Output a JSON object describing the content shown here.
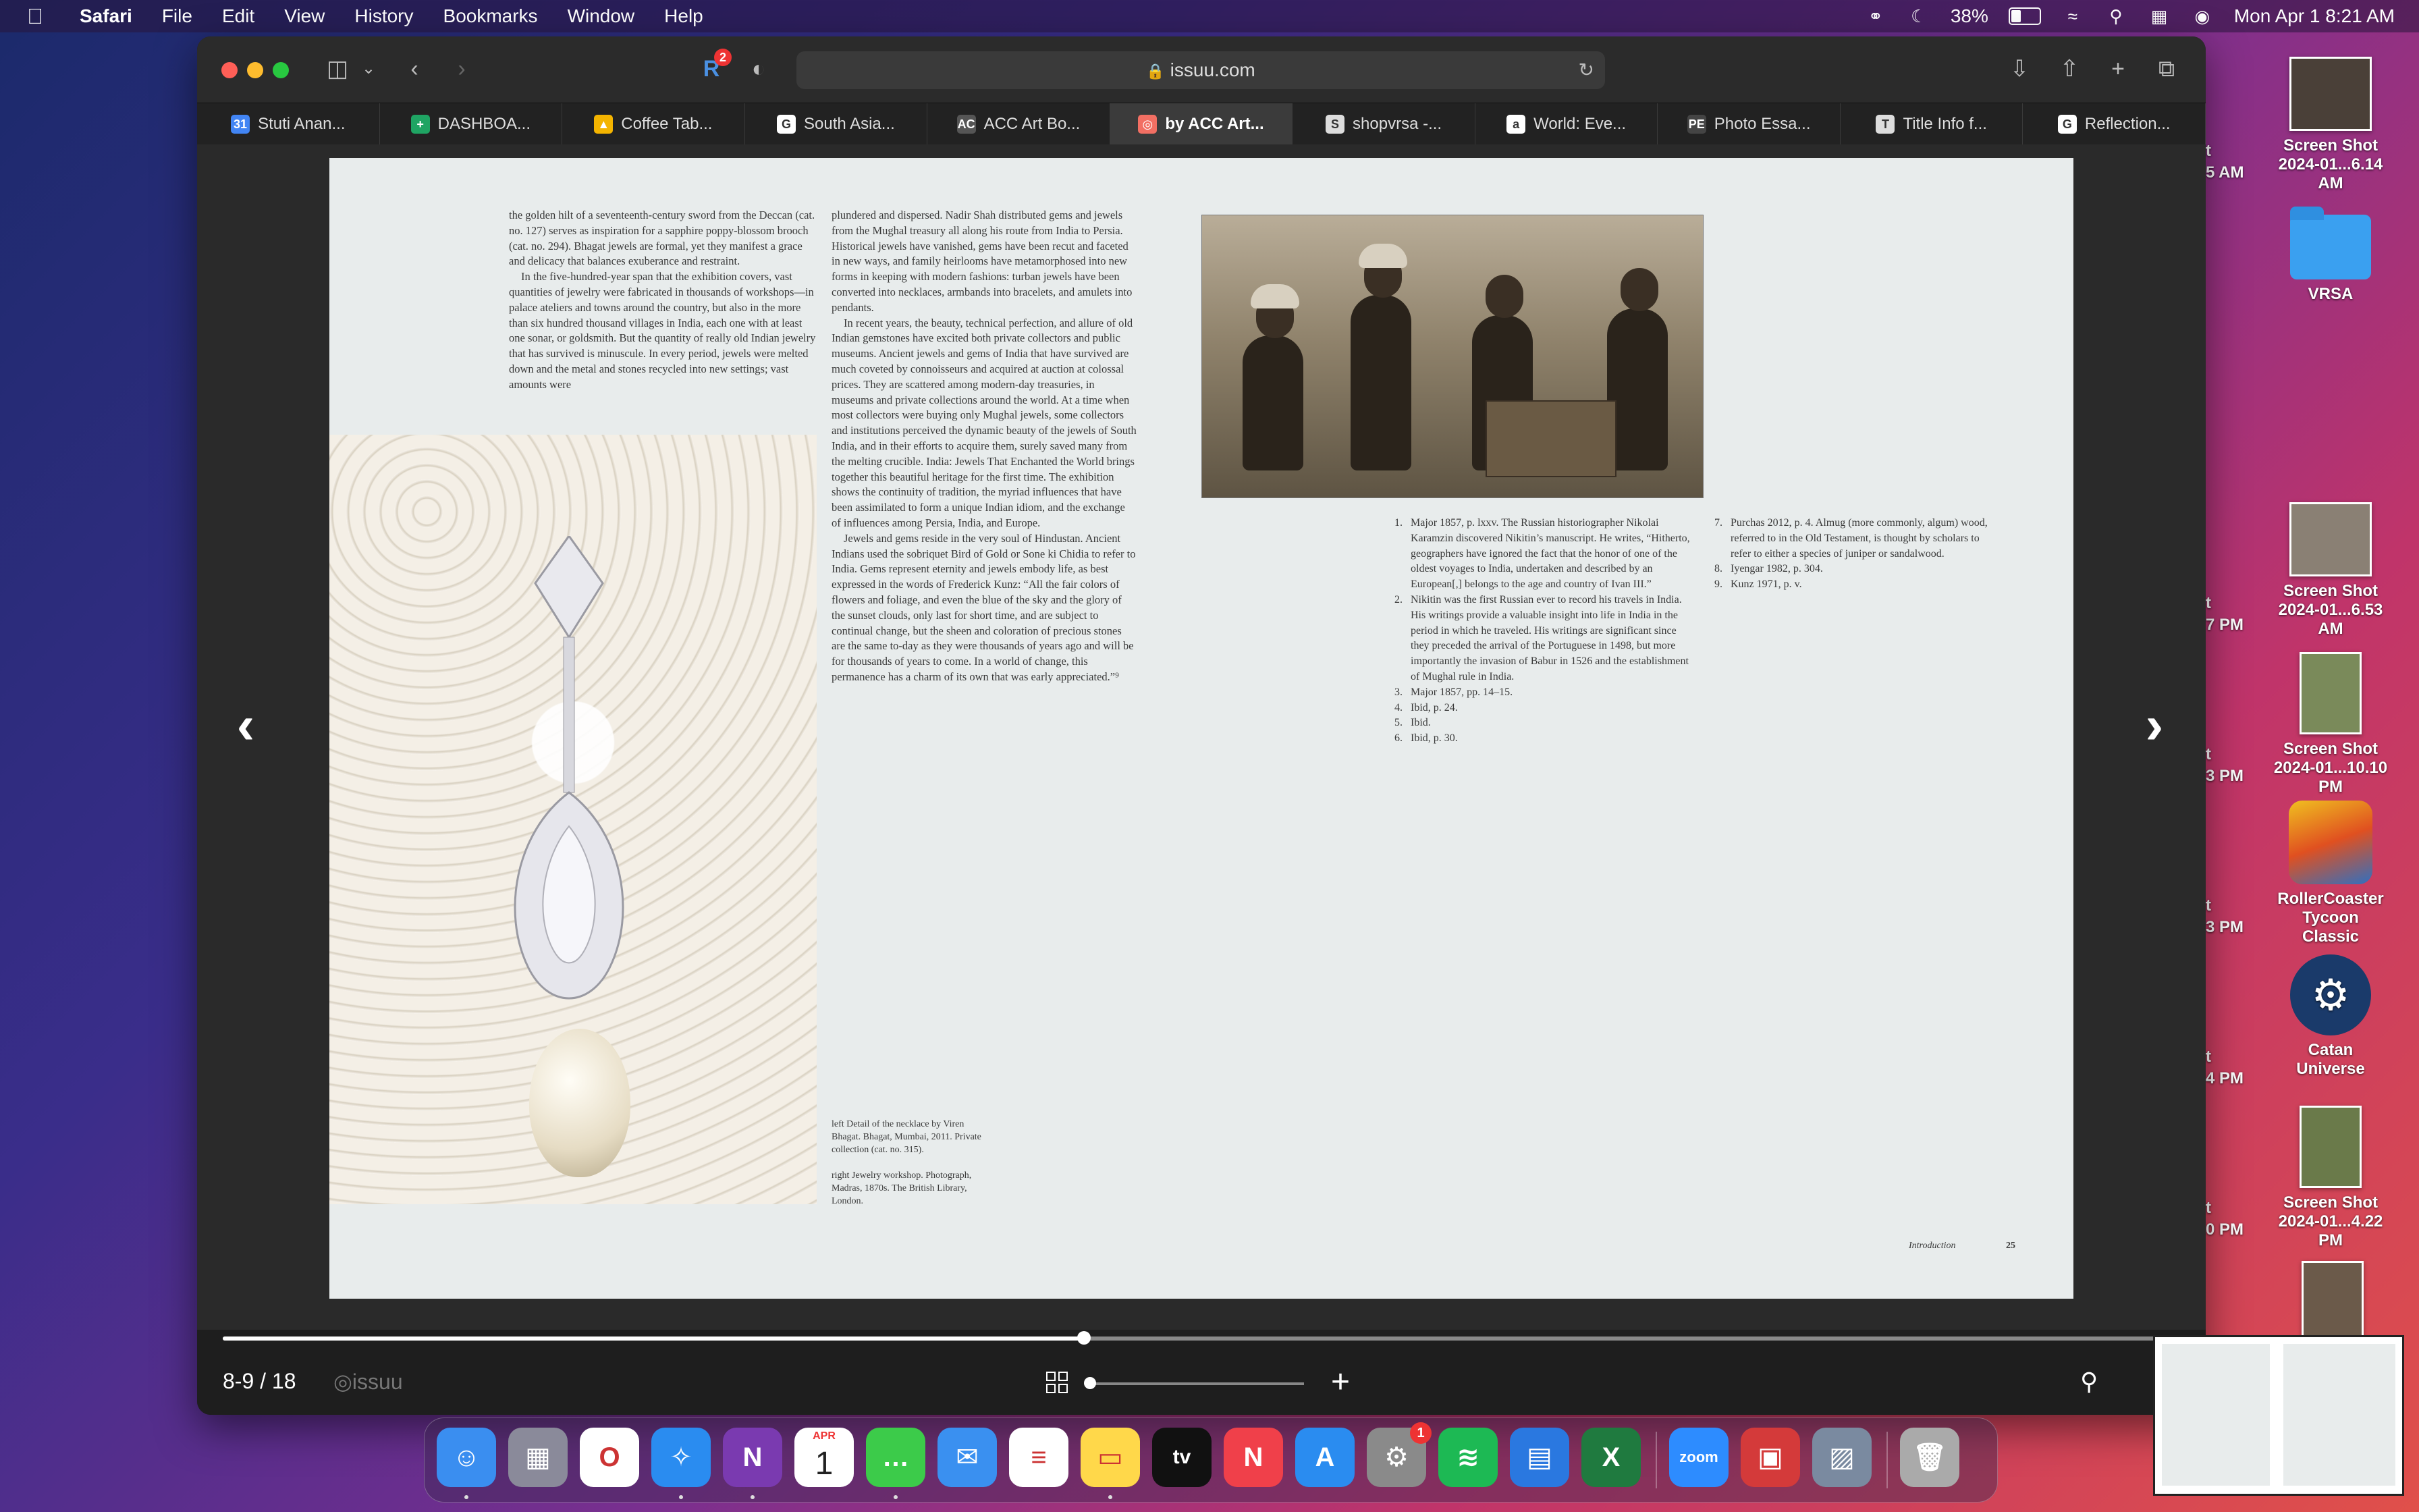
{
  "menubar": {
    "app_name": "Safari",
    "menus": [
      "File",
      "Edit",
      "View",
      "History",
      "Bookmarks",
      "Window",
      "Help"
    ],
    "battery_percent": "38%",
    "datetime": "Mon Apr 1  8:21 AM"
  },
  "desktop": {
    "items": [
      {
        "label1": "Screen Shot",
        "label2": "2024-01...6.14 AM"
      },
      {
        "label1": "VRSA",
        "label2": ""
      },
      {
        "label1": "Screen Shot",
        "label2": "2024-01...6.53 AM"
      },
      {
        "label1": "Screen Shot",
        "label2": "2024-01...10.10 PM"
      },
      {
        "label1": "RollerCoaster",
        "label2": "Tycoon Classic"
      },
      {
        "label1": "Catan Universe",
        "label2": ""
      },
      {
        "label1": "Screen Shot",
        "label2": "2024-01...4.22 PM"
      }
    ],
    "cut_labels": [
      "t",
      "5 AM",
      "t",
      "7 PM",
      "t",
      "3 PM",
      "t",
      "3 PM",
      "t",
      "4 PM",
      "t",
      "0 PM"
    ]
  },
  "browser": {
    "address": "issuu.com",
    "extension_badge": "2",
    "tabs": [
      {
        "label": "Stuti Anan...",
        "icon": "calendar-icon",
        "color": "#4285f4",
        "glyph": "31"
      },
      {
        "label": "DASHBOA...",
        "icon": "sheets-icon",
        "color": "#1fa463",
        "glyph": "+"
      },
      {
        "label": "Coffee Tab...",
        "icon": "drive-icon",
        "color": "#f4b400",
        "glyph": "▲"
      },
      {
        "label": "South Asia...",
        "icon": "google-icon",
        "color": "#ffffff",
        "glyph": "G"
      },
      {
        "label": "ACC Art Bo...",
        "icon": "acc-icon",
        "color": "#555555",
        "glyph": "AC"
      },
      {
        "label": "by ACC Art...",
        "icon": "issuu-icon",
        "color": "#f26f63",
        "glyph": "◎",
        "active": true
      },
      {
        "label": "shopvrsa -...",
        "icon": "shopify-icon",
        "color": "#dddddd",
        "glyph": "S"
      },
      {
        "label": "World: Eve...",
        "icon": "amazon-icon",
        "color": "#ffffff",
        "glyph": "a"
      },
      {
        "label": "Photo Essa...",
        "icon": "photo-essay-icon",
        "color": "#444444",
        "glyph": "PE"
      },
      {
        "label": "Title Info f...",
        "icon": "titleinfo-icon",
        "color": "#dddddd",
        "glyph": "T"
      },
      {
        "label": "Reflection...",
        "icon": "google-icon",
        "color": "#ffffff",
        "glyph": "G"
      }
    ]
  },
  "document": {
    "col1": [
      "the golden hilt of a seventeenth-century sword from the Deccan (cat. no. 127) serves as inspiration for a sapphire poppy-blossom brooch (cat. no. 294). Bhagat jewels are formal, yet they manifest a grace and delicacy that balances exuberance and restraint.",
      "In the five-hundred-year span that the exhibition covers, vast quantities of jewelry were fabricated in thousands of workshops—in palace ateliers and towns around the country, but also in the more than six hundred thousand villages in India, each one with at least one sonar, or goldsmith. But the quantity of really old Indian jewelry that has survived is minuscule. In every period, jewels were melted down and the metal and stones recycled into new settings; vast amounts were"
    ],
    "col2": [
      "plundered and dispersed. Nadir Shah distributed gems and jewels from the Mughal treasury all along his route from India to Persia. Historical jewels have vanished, gems have been recut and faceted in new ways, and family heirlooms have metamorphosed into new forms in keeping with modern fashions: turban jewels have been converted into necklaces, armbands into bracelets, and amulets into pendants.",
      "In recent years, the beauty, technical perfection, and allure of old Indian gemstones have excited both private collectors and public museums. Ancient jewels and gems of India that have survived are much coveted by connoisseurs and acquired at auction at colossal prices. They are scattered among modern-day treasuries, in museums and private collections around the world. At a time when most collectors were buying only Mughal jewels, some collectors and institutions perceived the dynamic beauty of the jewels of South India, and in their efforts to acquire them, surely saved many from the melting crucible. India: Jewels That Enchanted the World brings together this beautiful heritage for the first time. The exhibition shows the continuity of tradition, the myriad influences that have been assimilated to form a unique Indian idiom, and the exchange of influences among Persia, India, and Europe.",
      "Jewels and gems reside in the very soul of Hindustan. Ancient Indians used the sobriquet Bird of Gold or Sone ki Chidia to refer to India. Gems represent eternity and jewels embody life, as best expressed in the words of Frederick Kunz: “All the fair colors of flowers and foliage, and even the blue of the sky and the glory of the sunset clouds, only last for short time, and are subject to continual change, but the sheen and coloration of precious stones are the same to-day as they were thousands of years ago and will be for thousands of years to come. In a world of change, this permanence has a charm of its own that was early appreciated.”⁹"
    ],
    "captions": [
      "left  Detail of the necklace by Viren Bhagat. Bhagat, Mumbai, 2011. Private collection (cat. no. 315).",
      "right  Jewelry workshop. Photograph, Madras, 1870s. The British Library, London."
    ],
    "notes_left": [
      {
        "num": "1.",
        "text": "Major 1857, p. lxxv. The Russian historiographer Nikolai Karamzin discovered Nikitin’s manuscript. He writes, “Hitherto, geographers have ignored the fact that the honor of one of the oldest voyages to India, undertaken and described by an European[,] belongs to the age and country of Ivan III.”"
      },
      {
        "num": "2.",
        "text": "Nikitin was the first Russian ever to record his travels in India. His writings provide a valuable insight into life in India in the period in which he traveled. His writings are significant since they preceded the arrival of the Portuguese in 1498, but more importantly the invasion of Babur in 1526 and the establishment of Mughal rule in India."
      },
      {
        "num": "3.",
        "text": "Major 1857, pp. 14–15."
      },
      {
        "num": "4.",
        "text": "Ibid, p. 24."
      },
      {
        "num": "5.",
        "text": "Ibid."
      },
      {
        "num": "6.",
        "text": "Ibid, p. 30."
      }
    ],
    "notes_right": [
      {
        "num": "7.",
        "text": "Purchas 2012, p. 4. Almug (more commonly, algum) wood, referred to in the Old Testament, is thought by scholars to refer to either a species of juniper or sandalwood."
      },
      {
        "num": "8.",
        "text": "Iyengar 1982, p. 304."
      },
      {
        "num": "9.",
        "text": "Kunz 1971, p. v."
      }
    ],
    "running_head": "Introduction",
    "page_number": "25"
  },
  "viewer": {
    "page_indicator": "8-9 / 18",
    "brand": "issuu",
    "progress_fraction": 0.44,
    "zoom_fraction": 0.0
  },
  "dock": {
    "apps": [
      {
        "name": "finder",
        "color": "#3a8ef0",
        "glyph": "☺",
        "running": true
      },
      {
        "name": "launchpad",
        "color": "#8a8a9a",
        "glyph": "▦",
        "running": false
      },
      {
        "name": "opera",
        "color": "#ffffff",
        "glyph": "O",
        "running": false
      },
      {
        "name": "safari",
        "color": "#2a8cf0",
        "glyph": "✧",
        "running": true
      },
      {
        "name": "onenote",
        "color": "#7a3ab0",
        "glyph": "N",
        "running": true
      },
      {
        "name": "calendar",
        "color": "#ffffff",
        "glyph": "1",
        "running": false
      },
      {
        "name": "messages",
        "color": "#3ccb4a",
        "glyph": "…",
        "running": true
      },
      {
        "name": "mail",
        "color": "#3a90f0",
        "glyph": "✉",
        "running": false
      },
      {
        "name": "reminders",
        "color": "#ffffff",
        "glyph": "≡",
        "running": false
      },
      {
        "name": "notes",
        "color": "#ffd84a",
        "glyph": "▭",
        "running": true
      },
      {
        "name": "appletv",
        "color": "#111111",
        "glyph": "tv",
        "running": false
      },
      {
        "name": "news",
        "color": "#f0404a",
        "glyph": "N",
        "running": false
      },
      {
        "name": "appstore",
        "color": "#2a8cf0",
        "glyph": "A",
        "running": false
      },
      {
        "name": "systemsettings",
        "color": "#8a8a8a",
        "glyph": "⚙",
        "running": false,
        "badge": "1"
      },
      {
        "name": "spotify",
        "color": "#1db954",
        "glyph": "≋",
        "running": false
      },
      {
        "name": "keynote",
        "color": "#2a78e0",
        "glyph": "▤",
        "running": false
      },
      {
        "name": "excel",
        "color": "#1f7a3f",
        "glyph": "X",
        "running": false
      },
      {
        "name": "zoom",
        "color": "#2d8cff",
        "glyph": "zoom",
        "running": false
      },
      {
        "name": "photobooth",
        "color": "#d43a3a",
        "glyph": "▣",
        "running": false
      },
      {
        "name": "preview",
        "color": "#7a8aa0",
        "glyph": "▨",
        "running": false
      },
      {
        "name": "trash",
        "color": "#aaaaaa",
        "glyph": "🗑",
        "running": false
      }
    ],
    "calendar_month": "APR"
  }
}
